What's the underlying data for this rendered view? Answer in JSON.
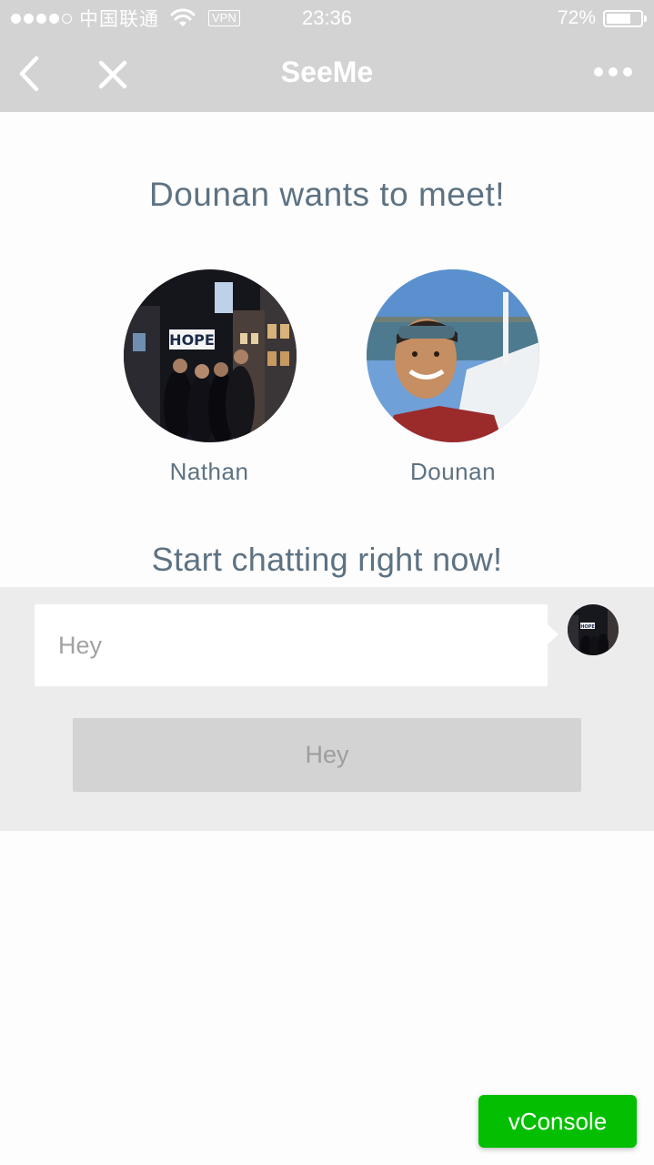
{
  "status_bar": {
    "signal": "●●●●○",
    "carrier": "中国联通",
    "vpn_label": "VPN",
    "time": "23:36",
    "battery_percent_text": "72%",
    "battery_level": 0.72
  },
  "nav": {
    "title": "SeeMe",
    "back_icon": "chevron-left-icon",
    "close_icon": "close-icon",
    "more_icon": "more-dots-icon"
  },
  "headline": {
    "name": "Dounan",
    "suffix": " wants to meet!"
  },
  "profiles": [
    {
      "name": "Nathan"
    },
    {
      "name": "Dounan"
    }
  ],
  "chat": {
    "heading": "Start chatting right now!",
    "message_placeholder": "Hey",
    "send_label": "Hey"
  },
  "vconsole": {
    "label": "vConsole"
  },
  "colors": {
    "bar_gray": "#d3d3d3",
    "text_slate": "#5d7282",
    "highlight_mint": "#a8eddb",
    "chat_bg": "#ececec",
    "vconsole_green": "#04be02"
  }
}
